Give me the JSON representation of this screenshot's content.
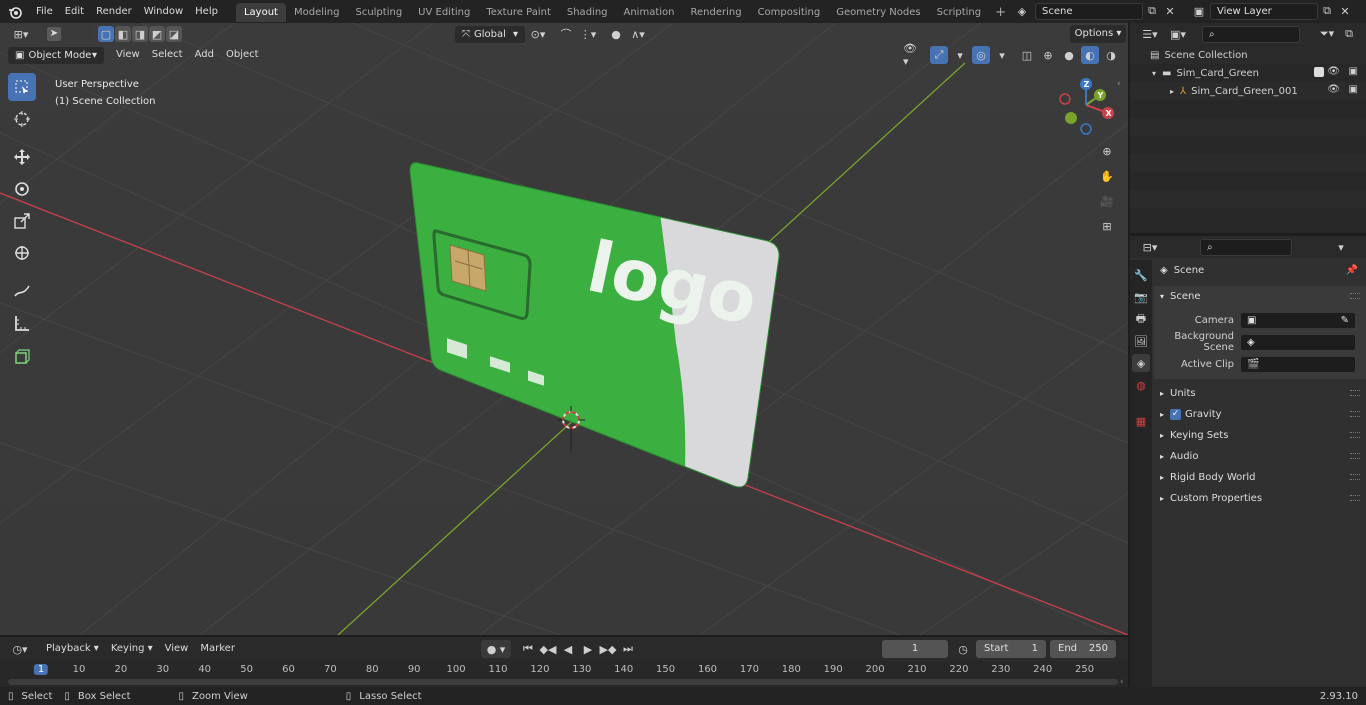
{
  "topbar": {
    "menus": [
      "File",
      "Edit",
      "Render",
      "Window",
      "Help"
    ],
    "workspaces": [
      "Layout",
      "Modeling",
      "Sculpting",
      "UV Editing",
      "Texture Paint",
      "Shading",
      "Animation",
      "Rendering",
      "Compositing",
      "Geometry Nodes",
      "Scripting"
    ],
    "active_workspace": "Layout",
    "scene_name": "Scene",
    "view_layer": "View Layer"
  },
  "viewport": {
    "mode": "Object Mode",
    "menus": [
      "View",
      "Select",
      "Add",
      "Object"
    ],
    "orientation": "Global",
    "options_label": "Options",
    "overlay_line1": "User Perspective",
    "overlay_line2": "(1) Scene Collection",
    "card_logo_text": "logo",
    "gizmo_axes": {
      "x": "X",
      "y": "Y",
      "z": "Z"
    },
    "colors": {
      "card_green": "#3bb041",
      "card_white": "#d9d9db",
      "x_axis": "#c8414b",
      "y_axis": "#7aa32c",
      "selected_tool": "#4772b3"
    }
  },
  "outliner": {
    "root": "Scene Collection",
    "collection": "Sim_Card_Green",
    "object": "Sim_Card_Green_001"
  },
  "properties": {
    "header": "Scene",
    "panel": "Scene",
    "camera_label": "Camera",
    "background_scene_label": "Background Scene",
    "active_clip_label": "Active Clip",
    "subpanels": [
      "Units",
      "Gravity",
      "Keying Sets",
      "Audio",
      "Rigid Body World",
      "Custom Properties"
    ],
    "gravity_checked": true
  },
  "timeline": {
    "menus": [
      "Playback",
      "Keying",
      "View",
      "Marker"
    ],
    "current_frame": "1",
    "start_label": "Start",
    "start": "1",
    "end_label": "End",
    "end": "250",
    "ruler": [
      "1",
      "10",
      "20",
      "30",
      "40",
      "50",
      "60",
      "70",
      "80",
      "90",
      "100",
      "110",
      "120",
      "130",
      "140",
      "150",
      "160",
      "170",
      "180",
      "190",
      "200",
      "210",
      "220",
      "230",
      "240",
      "250"
    ]
  },
  "statusbar": {
    "select": "Select",
    "box_select": "Box Select",
    "zoom_view": "Zoom View",
    "lasso_select": "Lasso Select",
    "version": "2.93.10"
  }
}
